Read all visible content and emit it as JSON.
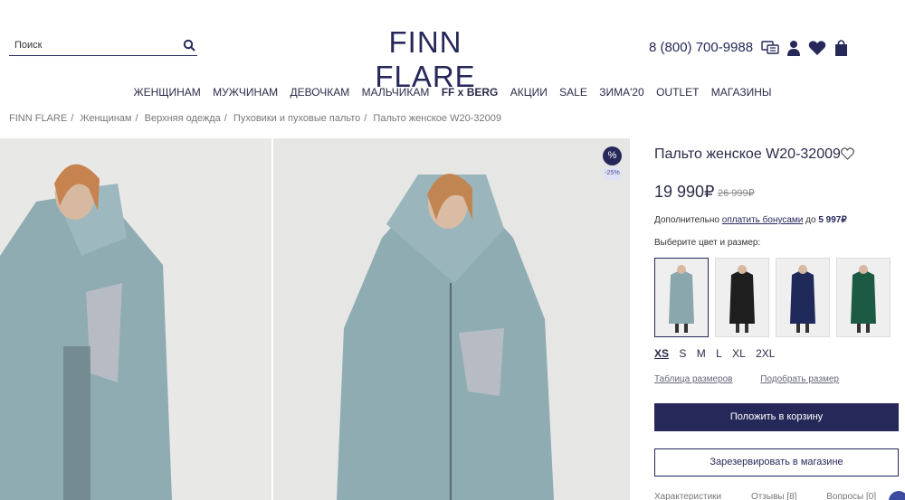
{
  "header": {
    "search_placeholder": "Поиск",
    "logo": "FINN FLARE",
    "phone": "8 (800) 700-9988"
  },
  "nav": [
    "ЖЕНЩИНАМ",
    "МУЖЧИНАМ",
    "ДЕВОЧКАМ",
    "МАЛЬЧИКАМ",
    "FF x BERG",
    "АКЦИИ",
    "SALE",
    "ЗИМА'20",
    "OUTLET",
    "МАГАЗИНЫ"
  ],
  "breadcrumb": [
    "FINN FLARE",
    "Женщинам",
    "Верхняя одежда",
    "Пуховики и пуховые пальто",
    "Пальто женское W20-32009"
  ],
  "badges": {
    "pct": "%",
    "discount": "-25%"
  },
  "product": {
    "title": "Пальто женское W20-32009",
    "price": "19 990₽",
    "old_price": "26 999₽",
    "bonus_prefix": "Дополнительно",
    "bonus_link": "оплатить бонусами",
    "bonus_mid": "до",
    "bonus_amount": "5 997₽",
    "choose_label": "Выберите цвет и размер:",
    "swatch_colors": [
      "#8aa7ad",
      "#1e1e1e",
      "#1f2a5a",
      "#1d5a44"
    ],
    "sizes": [
      "XS",
      "S",
      "M",
      "L",
      "XL",
      "2XL"
    ],
    "selected_size": "XS",
    "size_table": "Таблица размеров",
    "pick_size": "Подобрать размер",
    "cart_button": "Положить в корзину",
    "reserve_button": "Зарезервировать в магазине",
    "tabs": [
      "Характеристики",
      "Отзывы [8]",
      "Вопросы [0]"
    ]
  }
}
